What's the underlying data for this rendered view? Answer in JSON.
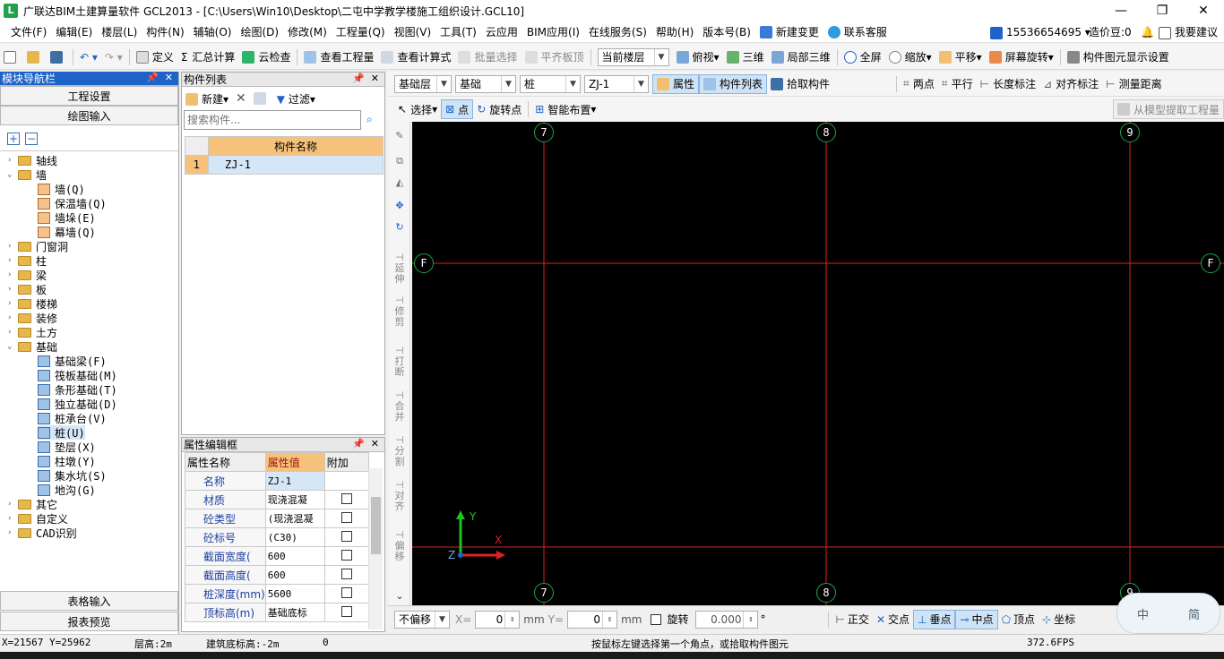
{
  "app": {
    "title": "广联达BIM土建算量软件 GCL2013 - [C:\\Users\\Win10\\Desktop\\二屯中学教学楼施工组织设计.GCL10]",
    "logo": "L",
    "controls": {
      "minimize": "—",
      "restore": "❐",
      "close": "✕"
    }
  },
  "menu": [
    "文件(F)",
    "编辑(E)",
    "楼层(L)",
    "构件(N)",
    "辅轴(O)",
    "绘图(D)",
    "修改(M)",
    "工程量(Q)",
    "视图(V)",
    "工具(T)",
    "云应用",
    "BIM应用(I)",
    "在线服务(S)",
    "帮助(H)",
    "版本号(B)",
    "新建变更",
    "联系客服"
  ],
  "account": {
    "phone": "15536654695 ▾",
    "cost_points": "造价豆:0",
    "feedback": "我要建议"
  },
  "toolbar1": {
    "define": "定义",
    "sum_calc": "汇总计算",
    "cloud_check": "云检查",
    "view_quantity": "查看工程量",
    "view_formula": "查看计算式",
    "batch_select": "批量选择",
    "flush_slab": "平齐板顶",
    "floor_combo": "当前楼层",
    "top_view": "俯视",
    "three_d": "三维",
    "local_3d": "局部三维",
    "full_screen": "全屏",
    "zoom": "缩放",
    "pan": "平移",
    "screen_rotate": "屏幕旋转",
    "display_settings": "构件图元显示设置"
  },
  "module_nav": {
    "header": "模块导航栏",
    "project_settings": "工程设置",
    "drawing_input": "绘图输入",
    "table_input": "表格输入",
    "report_preview": "报表预览",
    "tree": [
      {
        "label": "轴线",
        "level": 0,
        "expanded": false
      },
      {
        "label": "墙",
        "level": 0,
        "expanded": true
      },
      {
        "label": "墙(Q)",
        "level": 1
      },
      {
        "label": "保温墙(Q)",
        "level": 1
      },
      {
        "label": "墙垛(E)",
        "level": 1
      },
      {
        "label": "幕墙(Q)",
        "level": 1
      },
      {
        "label": "门窗洞",
        "level": 0,
        "expanded": false
      },
      {
        "label": "柱",
        "level": 0,
        "expanded": false
      },
      {
        "label": "梁",
        "level": 0,
        "expanded": false
      },
      {
        "label": "板",
        "level": 0,
        "expanded": false
      },
      {
        "label": "楼梯",
        "level": 0,
        "expanded": false
      },
      {
        "label": "装修",
        "level": 0,
        "expanded": false
      },
      {
        "label": "土方",
        "level": 0,
        "expanded": false
      },
      {
        "label": "基础",
        "level": 0,
        "expanded": true
      },
      {
        "label": "基础梁(F)",
        "level": 1
      },
      {
        "label": "筏板基础(M)",
        "level": 1
      },
      {
        "label": "条形基础(T)",
        "level": 1
      },
      {
        "label": "独立基础(D)",
        "level": 1
      },
      {
        "label": "桩承台(V)",
        "level": 1
      },
      {
        "label": "桩(U)",
        "level": 1,
        "selected": true
      },
      {
        "label": "垫层(X)",
        "level": 1
      },
      {
        "label": "柱墩(Y)",
        "level": 1
      },
      {
        "label": "集水坑(S)",
        "level": 1
      },
      {
        "label": "地沟(G)",
        "level": 1
      },
      {
        "label": "其它",
        "level": 0,
        "expanded": false
      },
      {
        "label": "自定义",
        "level": 0,
        "expanded": false
      },
      {
        "label": "CAD识别",
        "level": 0,
        "expanded": false
      }
    ]
  },
  "component_list": {
    "header": "构件列表",
    "new_btn": "新建",
    "filter_btn": "过滤",
    "search_placeholder": "搜索构件...",
    "column": "构件名称",
    "rows": [
      {
        "index": "1",
        "name": "ZJ-1"
      }
    ]
  },
  "property_editor": {
    "header": "属性编辑框",
    "columns": [
      "属性名称",
      "属性值",
      "附加"
    ],
    "rows": [
      {
        "name": "名称",
        "value": "ZJ-1",
        "has_check": false
      },
      {
        "name": "材质",
        "value": "现浇混凝",
        "has_check": true
      },
      {
        "name": "砼类型",
        "value": "(现浇混凝",
        "has_check": true
      },
      {
        "name": "砼标号",
        "value": "(C30)",
        "has_check": true
      },
      {
        "name": "截面宽度(",
        "value": "600",
        "has_check": true
      },
      {
        "name": "截面高度(",
        "value": "600",
        "has_check": true
      },
      {
        "name": "桩深度(mm)",
        "value": "5600",
        "has_check": true
      },
      {
        "name": "顶标高(m)",
        "value": "基础底标",
        "has_check": true
      }
    ]
  },
  "drawing_toolbar": {
    "floor": "基础层",
    "category": "基础",
    "type": "桩",
    "component": "ZJ-1",
    "attributes": "属性",
    "component_list": "构件列表",
    "pick_component": "拾取构件",
    "two_points": "两点",
    "parallel": "平行",
    "length_dim": "长度标注",
    "align_dim": "对齐标注",
    "measure": "测量距离",
    "select": "选择",
    "point": "点",
    "rotate_point": "旋转点",
    "smart_layout": "智能布置",
    "extract_quantity": "从模型提取工程量"
  },
  "side_tools": [
    "延伸",
    "修剪",
    "打断",
    "合并",
    "分割",
    "对齐",
    "偏移"
  ],
  "canvas": {
    "axes_top": [
      "7",
      "8",
      "9"
    ],
    "axes_side": [
      "F"
    ],
    "ucs_y": "Y",
    "ucs_x": "X",
    "ucs_z": "Z"
  },
  "bottom_bar": {
    "offset_mode": "不偏移",
    "x_label": "X=",
    "x_value": "0",
    "mm": "mm",
    "y_label": "Y=",
    "y_value": "0",
    "rotate_label": "旋转",
    "rotate_value": "0.000",
    "degree": "°",
    "snaps": [
      "正交",
      "交点",
      "垂点",
      "中点",
      "顶点",
      "坐标"
    ]
  },
  "status": {
    "coords": "X=21567 Y=25962",
    "floor_height": "层高:2m",
    "base_elev": "建筑底标高:-2m",
    "count": "0",
    "hint": "按鼠标左键选择第一个角点，或拾取构件图元",
    "fps": "372.6FPS"
  },
  "ime": {
    "mode": "中",
    "variant": "简"
  },
  "colors": {
    "accent_blue": "#1e64c8",
    "grid_red": "#e02020",
    "canvas_bg": "#000000",
    "header_orange": "#f6c27b",
    "axis_circle_green": "#1fa34a"
  }
}
